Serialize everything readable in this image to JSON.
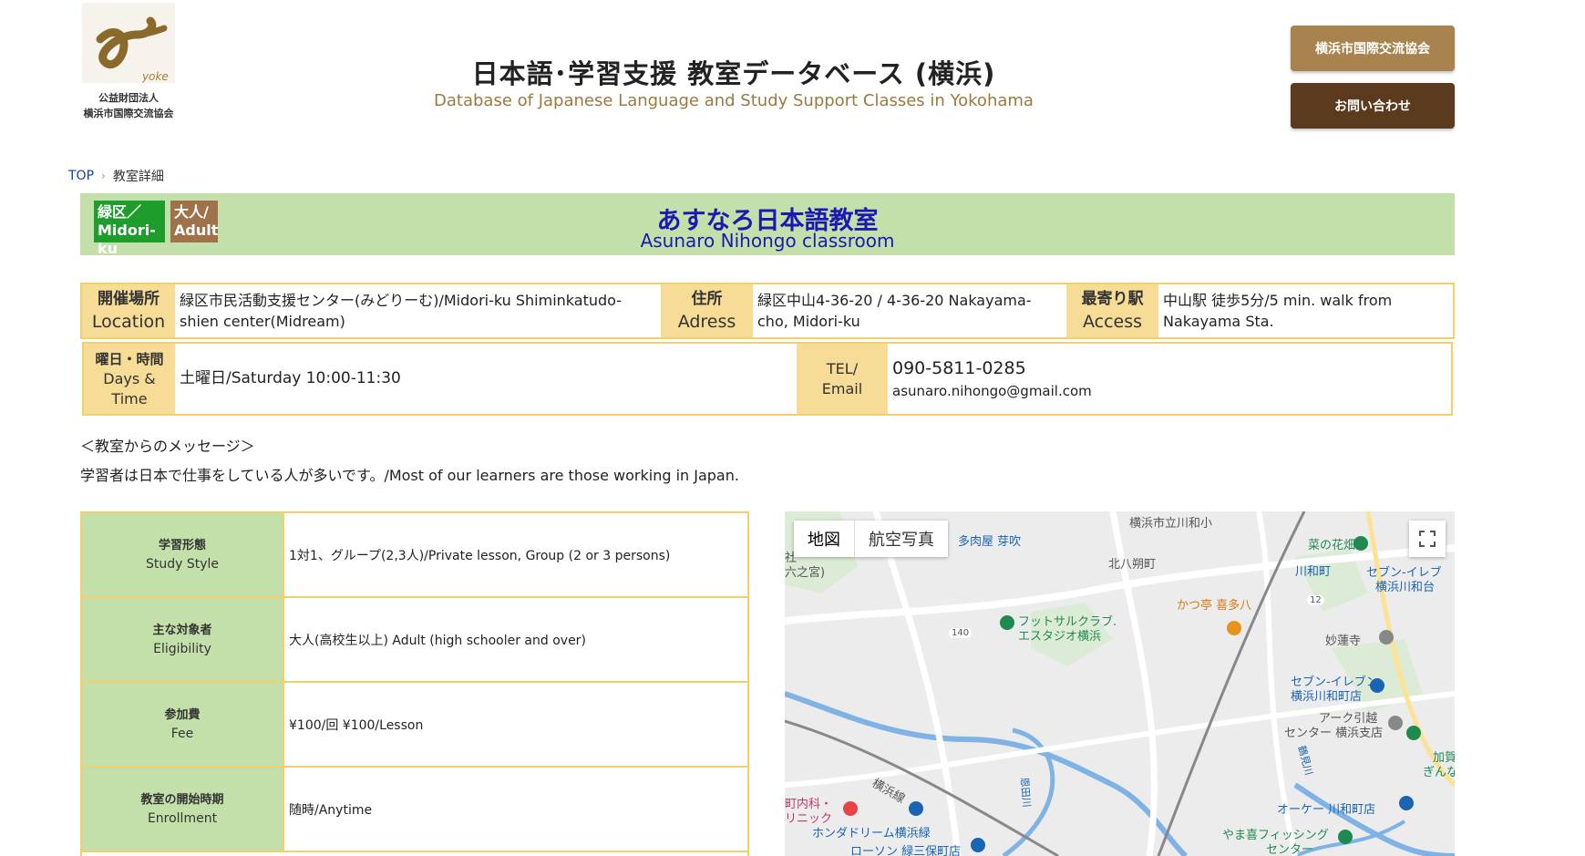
{
  "header": {
    "logo_text_line1": "公益財団法人",
    "logo_text_line2": "横浜市国際交流協会",
    "logo_mark": "yoke",
    "title": "日本語･学習支援 教室データベース (横浜)",
    "subtitle": "Database of Japanese Language and Study Support Classes in Yokohama",
    "assoc_button": "横浜市国際交流協会",
    "contact_button": "お問い合わせ",
    "colors": {
      "assoc": "#a9834d",
      "contact": "#5b3a1e",
      "subtitle": "#9a7a3e"
    }
  },
  "breadcrumb": {
    "top": "TOP",
    "separator": "›",
    "current": "教室詳細"
  },
  "classroom": {
    "badge_area_ja": "緑区／",
    "badge_area_en": "Midori-ku",
    "badge_target_ja": "大人/",
    "badge_target_en": "Adult",
    "name_ja": "あすなろ日本語教室",
    "name_en": "Asunaro Nihongo classroom"
  },
  "info": {
    "location_label_ja": "開催場所",
    "location_label_en": "Location",
    "location_value": "緑区市民活動支援センター(みどりーむ)/Midori-ku Shiminkatudo-shien center(Midream)",
    "address_label_ja": "住所",
    "address_label_en": "Adress",
    "address_value": "緑区中山4-36-20 / 4-36-20 Nakayama-cho, Midori-ku",
    "station_label_ja": "最寄り駅",
    "station_label_en": "Access",
    "station_value": "中山駅 徒歩5分/5 min. walk from Nakayama Sta.",
    "days_label_ja": "曜日・時間",
    "days_label_en": "Days & Time",
    "days_value": "土曜日/Saturday 10:00-11:30",
    "tel_label": "TEL/",
    "email_label": "Email",
    "tel_value": "090-5811-0285",
    "email_value": "asunaro.nihongo@gmail.com"
  },
  "message": {
    "heading": "＜教室からのメッセージ＞",
    "body": "学習者は日本で仕事をしている人が多いです。/Most of our learners are those working in Japan."
  },
  "details": [
    {
      "label_ja": "学習形態",
      "label_en": "Study Style",
      "value": "1対1、グループ(2,3人)/Private lesson, Group (2 or 3 persons)"
    },
    {
      "label_ja": "主な対象者",
      "label_en": "Eligibility",
      "value": "大人(高校生以上) Adult (high schooler and over)"
    },
    {
      "label_ja": "参加費",
      "label_en": "Fee",
      "value": "¥100/回  ¥100/Lesson"
    },
    {
      "label_ja": "教室の開始時期",
      "label_en": "Enrollment",
      "value": "随時/Anytime"
    }
  ],
  "map": {
    "tab_map": "地図",
    "tab_satellite": "航空写真",
    "fullscreen_icon": "fullscreen-icon",
    "labels": {
      "l1": "横浜市立川和小",
      "l2": "菜の花畑",
      "l3": "多肉屋 芽吹",
      "l4": "北八朔町",
      "l5": "川和町",
      "l6": "セブン-イレブ",
      "l7": "横浜川和台",
      "l8": "社",
      "l9": "六之宮)",
      "l10": "かつ亭 喜多八",
      "l11": "フットサルクラブ.",
      "l12": "エスタジオ横浜",
      "l13": "妙蓮寺",
      "l14": "140",
      "l15": "12",
      "l16": "セブン-イレブン",
      "l17": "横浜川和町店",
      "l18": "アーク引越",
      "l19": "センター 横浜支店",
      "l20": "加賀",
      "l21": "ぎんなん",
      "l22": "横浜線",
      "l23": "町内科・",
      "l24": "リニック",
      "l25": "オーケー 川和町店",
      "l26": "ホンダドリーム横浜緑",
      "l27": "ローソン 緑三保町店",
      "l28": "やま喜フィッシング",
      "l29": "センター",
      "l30": "鶴見川",
      "l31": "恩田川"
    }
  }
}
